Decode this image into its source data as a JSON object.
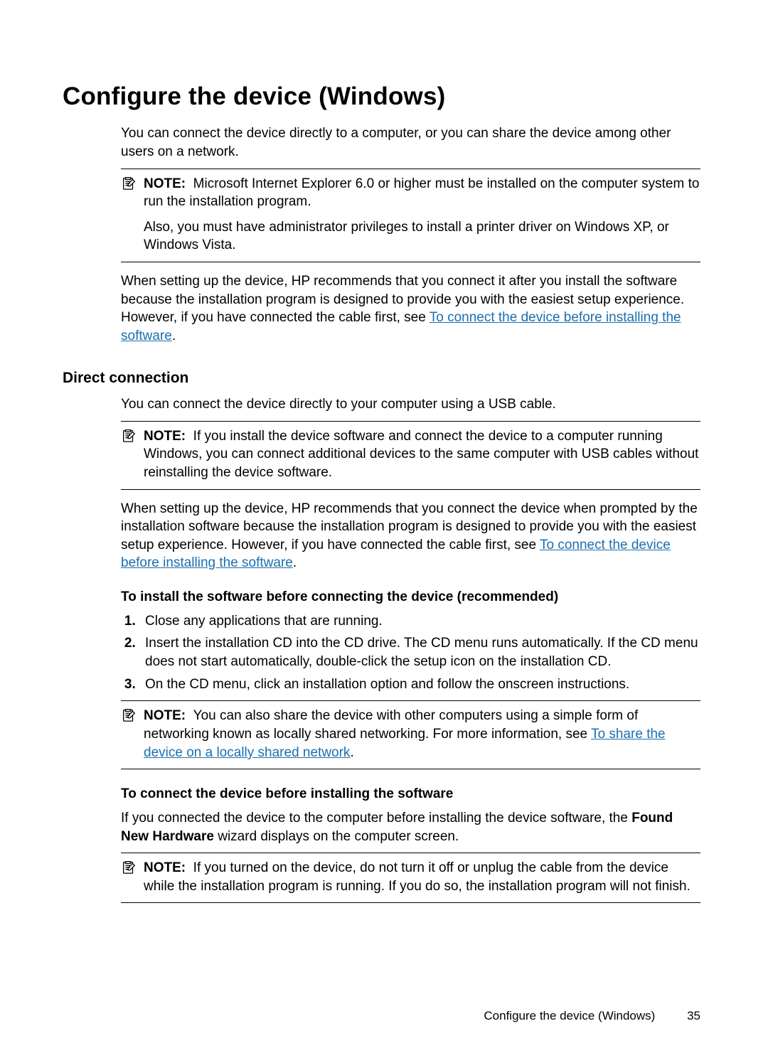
{
  "title": "Configure the device (Windows)",
  "intro": "You can connect the device directly to a computer, or you can share the device among other users on a network.",
  "note1": {
    "label": "NOTE:",
    "p1": "Microsoft Internet Explorer 6.0 or higher must be installed on the computer system to run the installation program.",
    "p2": "Also, you must have administrator privileges to install a printer driver on Windows XP, or Windows Vista."
  },
  "after_note1_pre": "When setting up the device, HP recommends that you connect it after you install the software because the installation program is designed to provide you with the easiest setup experience. However, if you have connected the cable first, see ",
  "after_note1_link": "To connect the device before installing the software",
  "after_note1_post": ".",
  "section_direct": "Direct connection",
  "direct_intro": "You can connect the device directly to your computer using a USB cable.",
  "note2": {
    "label": "NOTE:",
    "p1": "If you install the device software and connect the device to a computer running Windows, you can connect additional devices to the same computer with USB cables without reinstalling the device software."
  },
  "direct_para_pre": "When setting up the device, HP recommends that you connect the device when prompted by the installation software because the installation program is designed to provide you with the easiest setup experience. However, if you have connected the cable first, see ",
  "direct_para_link": "To connect the device before installing the software",
  "direct_para_post": ".",
  "sub_install": "To install the software before connecting the device (recommended)",
  "steps": [
    "Close any applications that are running.",
    "Insert the installation CD into the CD drive. The CD menu runs automatically. If the CD menu does not start automatically, double-click the setup icon on the installation CD.",
    "On the CD menu, click an installation option and follow the onscreen instructions."
  ],
  "note3": {
    "label": "NOTE:",
    "pre": "You can also share the device with other computers using a simple form of networking known as locally shared networking. For more information, see ",
    "link": "To share the device on a locally shared network",
    "post": "."
  },
  "sub_connect": "To connect the device before installing the software",
  "connect_para_pre": "If you connected the device to the computer before installing the device software, the ",
  "connect_para_bold": "Found New Hardware",
  "connect_para_post": " wizard displays on the computer screen.",
  "note4": {
    "label": "NOTE:",
    "p1": "If you turned on the device, do not turn it off or unplug the cable from the device while the installation program is running. If you do so, the installation program will not finish."
  },
  "footer_text": "Configure the device (Windows)",
  "page_number": "35"
}
